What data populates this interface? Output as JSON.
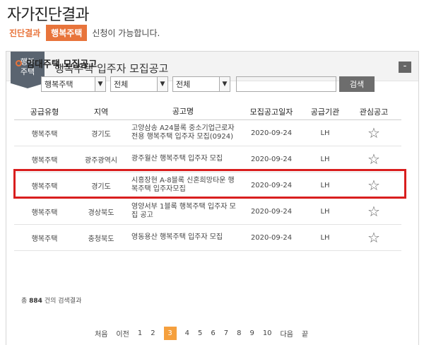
{
  "page": {
    "title": "자가진단결과"
  },
  "result": {
    "label": "진단결과",
    "badge": "행복주택",
    "text": "신청이 가능합니다."
  },
  "panel": {
    "ribbon_line1": "행복",
    "ribbon_line2": "주택",
    "title": "행복주택 입주자 모집공고",
    "collapse": "-"
  },
  "section": {
    "title": "임대주택 모집공고"
  },
  "filters": {
    "type": "행복주택",
    "region": "전체",
    "status": "전체",
    "search_value": "",
    "search_button": "검색",
    "arrow": "▼"
  },
  "table": {
    "headers": [
      "공급유형",
      "지역",
      "공고명",
      "모집공고일자",
      "공급기관",
      "관심공고"
    ],
    "rows": [
      {
        "type": "행복주택",
        "region": "경기도",
        "title": "고양삼송 A24블록 중소기업근로자 전용 행복주택 입주자 모집(0924)",
        "date": "2020-09-24",
        "agency": "LH"
      },
      {
        "type": "행복주택",
        "region": "광주광역시",
        "title": "광주월산 행복주택 입주자 모집",
        "date": "2020-09-24",
        "agency": "LH"
      },
      {
        "type": "행복주택",
        "region": "경기도",
        "title": "시흥장현 A-8블록 신혼희망타운 행복주택 입주자모집",
        "date": "2020-09-24",
        "agency": "LH"
      },
      {
        "type": "행복주택",
        "region": "경상북도",
        "title": "영양서부 1블록 행복주택 입주자 모집 공고",
        "date": "2020-09-24",
        "agency": "LH"
      },
      {
        "type": "행복주택",
        "region": "충청북도",
        "title": "영동용산 행복주택 입주자 모집",
        "date": "2020-09-24",
        "agency": "LH"
      }
    ],
    "star_icon": "☆"
  },
  "summary": {
    "prefix": "총",
    "count": "884",
    "suffix": "건의 검색결과"
  },
  "pagination": {
    "first": "처음",
    "prev": "이전",
    "pages": [
      "1",
      "2",
      "3",
      "4",
      "5",
      "6",
      "7",
      "8",
      "9",
      "10"
    ],
    "current": "3",
    "next": "다음",
    "last": "끝"
  }
}
